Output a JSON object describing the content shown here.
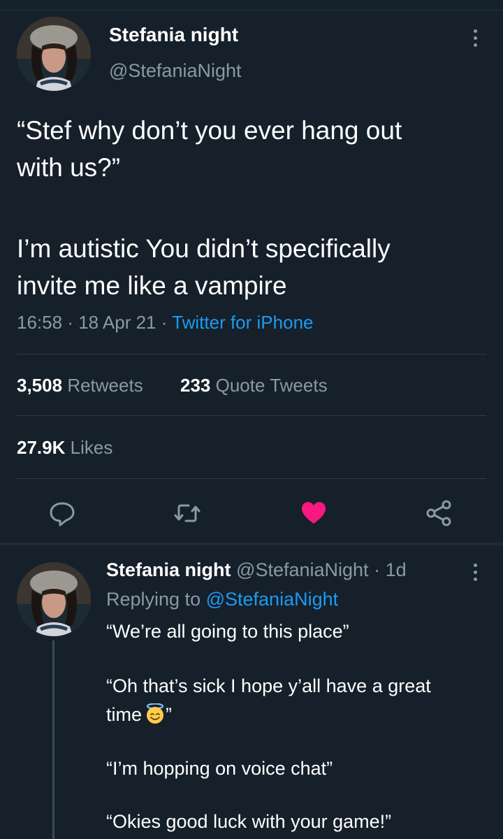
{
  "tweet": {
    "author_name": "Stefania night",
    "author_handle": "@StefaniaNight",
    "text_line1": "“Stef why don’t you ever hang out",
    "text_line2": "with us?”",
    "text_line3": "I’m autistic You didn’t specifically",
    "text_line4": "invite me like a vampire",
    "time": "16:58",
    "date": "18 Apr 21",
    "source": "Twitter for iPhone",
    "retweets_count": "3,508",
    "retweets_label": "Retweets",
    "quotes_count": "233",
    "quotes_label": "Quote Tweets",
    "likes_count": "27.9K",
    "likes_label": "Likes",
    "actions": [
      "reply-icon",
      "retweet-icon",
      "heart-icon",
      "share-icon"
    ],
    "liked": true
  },
  "reply": {
    "author_name": "Stefania night",
    "author_handle": "@StefaniaNight",
    "age": "1d",
    "replying_label": "Replying to",
    "replying_handle": "@StefaniaNight",
    "line1": "“We’re all going to this place”",
    "line2": "“Oh that’s sick I hope y’all have a great",
    "line3": "time",
    "line3_end": "”",
    "line4": "“I’m hopping on voice chat”",
    "line5": "“Okies good luck with your game!”",
    "emoji": "smiling-face-with-halo"
  },
  "colors": {
    "background": "#15202b",
    "muted": "#8b98a5",
    "link": "#1d9bf0",
    "like": "#f91880"
  }
}
